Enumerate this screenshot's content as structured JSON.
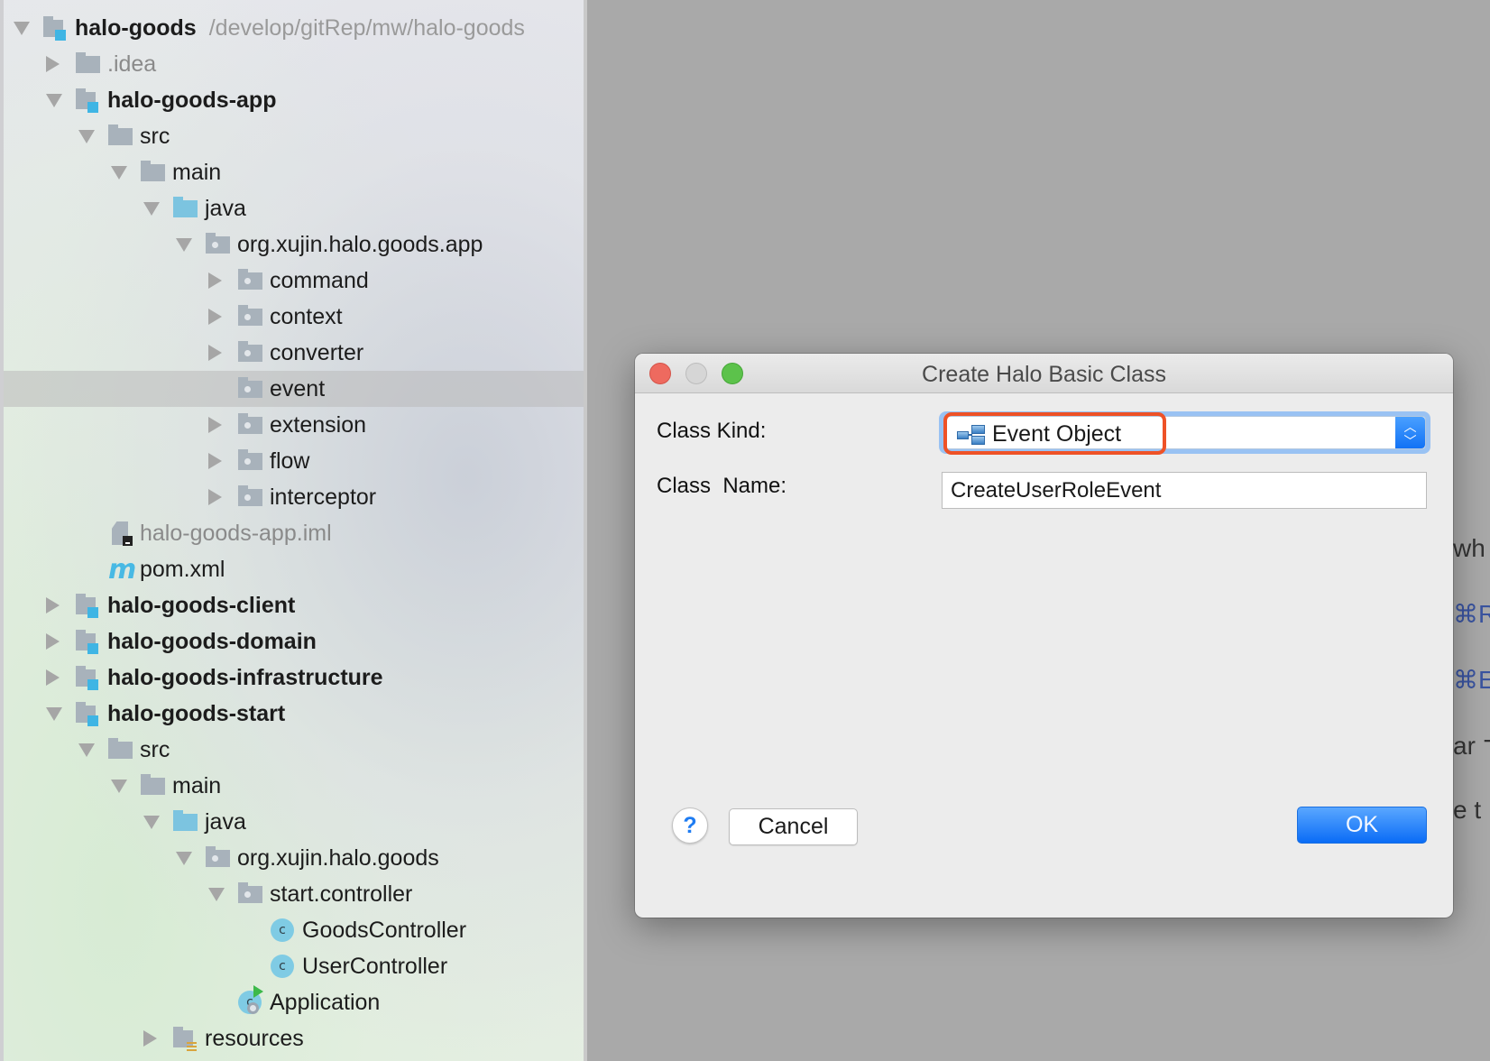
{
  "project_tree": {
    "rows": [
      {
        "label": "halo-goods",
        "path": "/develop/gitRep/mw/halo-goods",
        "level": 0,
        "arrow": "down",
        "icon": "module-folder-icon",
        "bold": true
      },
      {
        "label": ".idea",
        "level": 1,
        "arrow": "right",
        "icon": "folder-icon",
        "muted": true
      },
      {
        "label": "halo-goods-app",
        "level": 1,
        "arrow": "down",
        "icon": "module-folder-icon",
        "bold": true
      },
      {
        "label": "src",
        "level": 2,
        "arrow": "down",
        "icon": "folder-icon"
      },
      {
        "label": "main",
        "level": 3,
        "arrow": "down",
        "icon": "folder-icon"
      },
      {
        "label": "java",
        "level": 4,
        "arrow": "down",
        "icon": "source-folder-icon"
      },
      {
        "label": "org.xujin.halo.goods.app",
        "level": 5,
        "arrow": "down",
        "icon": "package-icon"
      },
      {
        "label": "command",
        "level": 6,
        "arrow": "right",
        "icon": "package-icon"
      },
      {
        "label": "context",
        "level": 6,
        "arrow": "right",
        "icon": "package-icon"
      },
      {
        "label": "converter",
        "level": 6,
        "arrow": "right",
        "icon": "package-icon"
      },
      {
        "label": "event",
        "level": 6,
        "arrow": "none",
        "icon": "package-icon",
        "selected": true
      },
      {
        "label": "extension",
        "level": 6,
        "arrow": "right",
        "icon": "package-icon"
      },
      {
        "label": "flow",
        "level": 6,
        "arrow": "right",
        "icon": "package-icon"
      },
      {
        "label": "interceptor",
        "level": 6,
        "arrow": "right",
        "icon": "package-icon"
      },
      {
        "label": "halo-goods-app.iml",
        "level": 2,
        "arrow": "none",
        "icon": "iml-file-icon",
        "muted": true
      },
      {
        "label": "pom.xml",
        "level": 2,
        "arrow": "none",
        "icon": "maven-icon"
      },
      {
        "label": "halo-goods-client",
        "level": 1,
        "arrow": "right",
        "icon": "module-folder-icon",
        "bold": true
      },
      {
        "label": "halo-goods-domain",
        "level": 1,
        "arrow": "right",
        "icon": "module-folder-icon",
        "bold": true
      },
      {
        "label": "halo-goods-infrastructure",
        "level": 1,
        "arrow": "right",
        "icon": "module-folder-icon",
        "bold": true
      },
      {
        "label": "halo-goods-start",
        "level": 1,
        "arrow": "down",
        "icon": "module-folder-icon",
        "bold": true
      },
      {
        "label": "src",
        "level": 2,
        "arrow": "down",
        "icon": "folder-icon"
      },
      {
        "label": "main",
        "level": 3,
        "arrow": "down",
        "icon": "folder-icon"
      },
      {
        "label": "java",
        "level": 4,
        "arrow": "down",
        "icon": "source-folder-icon"
      },
      {
        "label": "org.xujin.halo.goods",
        "level": 5,
        "arrow": "down",
        "icon": "package-icon"
      },
      {
        "label": "start.controller",
        "level": 6,
        "arrow": "down",
        "icon": "package-icon"
      },
      {
        "label": "GoodsController",
        "level": 7,
        "arrow": "none",
        "icon": "class-icon"
      },
      {
        "label": "UserController",
        "level": 7,
        "arrow": "none",
        "icon": "class-icon"
      },
      {
        "label": "Application",
        "level": 6,
        "arrow": "none",
        "icon": "spring-boot-class-icon"
      },
      {
        "label": "resources",
        "level": 4,
        "arrow": "right",
        "icon": "resources-folder-icon"
      }
    ]
  },
  "editor_hints": [
    {
      "text": "wh",
      "color": "dark"
    },
    {
      "text": "⌘R",
      "color": "blue"
    },
    {
      "text": "⌘E",
      "color": "blue"
    },
    {
      "text": "ar ⌥",
      "color": "dark"
    },
    {
      "text": "e t",
      "color": "dark"
    }
  ],
  "dialog": {
    "title": "Create Halo Basic Class",
    "class_kind_label": "Class Kind:",
    "class_kind_value": "Event Object",
    "class_kind_icon": "class-hierarchy-icon",
    "class_name_label": "Class  Name:",
    "class_name_value": "CreateUserRoleEvent",
    "help_label": "?",
    "cancel_label": "Cancel",
    "ok_label": "OK",
    "highlight_color": "#ee5227",
    "accent_color": "#1172f5"
  }
}
